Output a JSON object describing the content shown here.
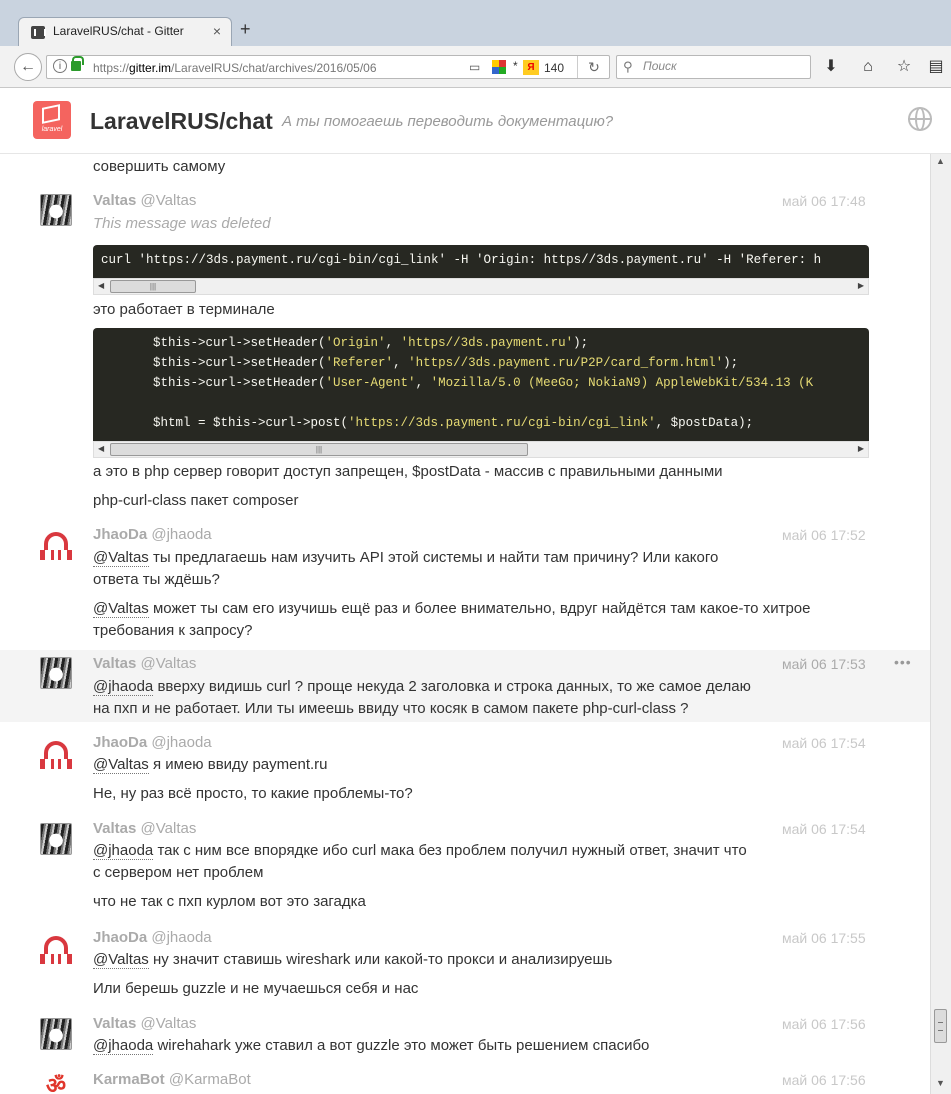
{
  "browser": {
    "tab_title": "LaravelRUS/chat - Gitter",
    "tab_close": "×",
    "new_tab": "+",
    "url_prefix": "https://",
    "url_host": "gitter.im",
    "url_path": "/LaravelRUS/chat/archives/2016/05/06",
    "yandex_count": "140",
    "yandex_letter": "Я",
    "search_placeholder": "Поиск",
    "reload": "↻",
    "back": "←"
  },
  "room": {
    "name": "LaravelRUS/chat",
    "topic": "А ты помогаешь переводить документацию?",
    "logo_text": "laravel"
  },
  "chat": {
    "messages": [
      {
        "lines": [
          "совершить самому"
        ]
      },
      {
        "user": "Valtas",
        "handle": "@Valtas",
        "time": "май 06 17:48",
        "lines": [
          "This message was deleted",
          "это работает в терминале",
          "а это в php сервер говорит доступ запрещен, $postData - массив с правильными данными",
          "php-curl-class пакет composer"
        ]
      },
      {
        "user": "JhaoDa",
        "handle": "@jhaoda",
        "time": "май 06 17:52",
        "mention1": "@Valtas",
        "lines": [
          "ты предлагаешь нам изучить API этой системы и найти там причину? Или какого",
          "ответа ты ждёшь?",
          "может ты сам его изучишь ещё раз и более внимательно, вдруг найдётся там какое-то хитрое",
          "требования к запросу?"
        ],
        "mention2": "@Valtas"
      },
      {
        "user": "Valtas",
        "handle": "@Valtas",
        "time": "май 06 17:53",
        "mention1": "@jhaoda",
        "lines": [
          "вверху видишь curl ? проще некуда 2 заголовка и строка данных, то же самое делаю",
          "на пхп и не работает. Или ты имеешь ввиду что косяк в самом пакете php-curl-class ?"
        ],
        "more": "•••"
      },
      {
        "user": "JhaoDa",
        "handle": "@jhaoda",
        "time": "май 06 17:54",
        "mention1": "@Valtas",
        "lines": [
          "я имею ввиду payment.ru",
          "Не, ну раз всё просто, то какие проблемы-то?"
        ]
      },
      {
        "user": "Valtas",
        "handle": "@Valtas",
        "time": "май 06 17:54",
        "mention1": "@jhaoda",
        "lines": [
          "так с ним все впорядке ибо curl мака без проблем получил нужный ответ, значит что",
          "с сервером нет проблем",
          "что не так с пхп курлом вот это загадка"
        ]
      },
      {
        "user": "JhaoDa",
        "handle": "@jhaoda",
        "time": "май 06 17:55",
        "mention1": "@Valtas",
        "lines": [
          "ну значит ставишь wireshark или какой-то прокси и анализируешь",
          "Или берешь guzzle и не мучаешься себя и нас"
        ]
      },
      {
        "user": "Valtas",
        "handle": "@Valtas",
        "time": "май 06 17:56",
        "mention1": "@jhaoda",
        "lines": [
          "wirehahark уже ставил а вот guzzle это может быть решением спасибо"
        ]
      },
      {
        "user": "KarmaBot",
        "handle": "@KarmaBot",
        "time": "май 06 17:56",
        "icon": "ॐ"
      }
    ],
    "code1": "curl 'https://3ds.payment.ru/cgi-bin/cgi_link' -H 'Origin: https//3ds.payment.ru' -H 'Referer: h",
    "code2": {
      "l1a": "        $this->curl->setHeader(",
      "l1b": "'Origin'",
      "l1c": ", ",
      "l1d": "'https//3ds.payment.ru'",
      "l1e": ");",
      "l2a": "        $this->curl->setHeader(",
      "l2b": "'Referer'",
      "l2c": ", ",
      "l2d": "'https//3ds.payment.ru/P2P/card_form.html'",
      "l2e": ");",
      "l3a": "        $this->curl->setHeader(",
      "l3b": "'User-Agent'",
      "l3c": ", ",
      "l3d": "'Mozilla/5.0 (MeeGo; NokiaN9) AppleWebKit/534.13 (K",
      "l5a": "        $html = $this->curl->post(",
      "l5b": "'https://3ds.payment.ru/cgi-bin/cgi_link'",
      "l5c": ", $postData);"
    },
    "scroll_grip": "|||"
  }
}
